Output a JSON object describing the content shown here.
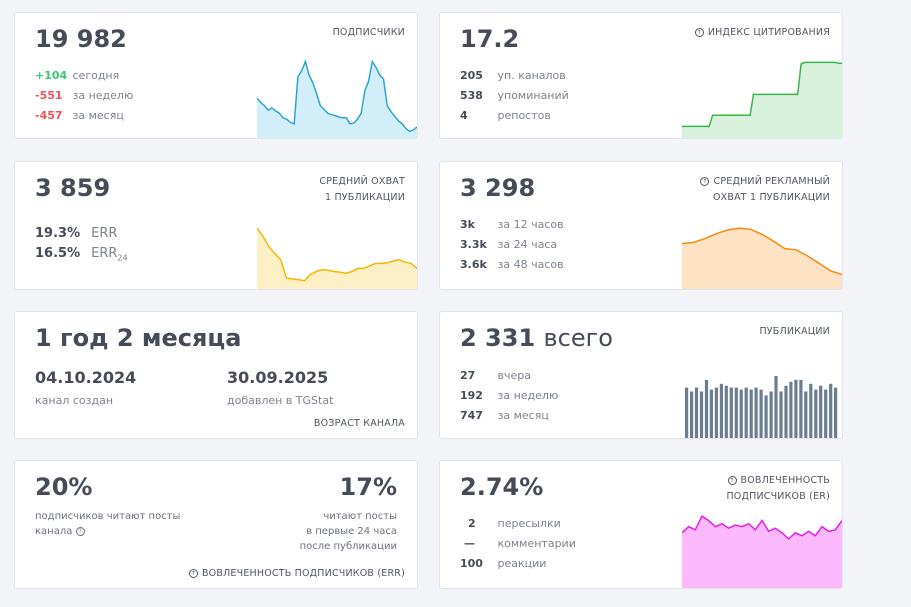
{
  "subscribers": {
    "value": "19 982",
    "title": "ПОДПИСЧИКИ",
    "rows": [
      {
        "v": "+104",
        "l": "сегодня",
        "c": "g"
      },
      {
        "v": "-551",
        "l": "за неделю",
        "c": "r"
      },
      {
        "v": "-457",
        "l": "за месяц",
        "c": "r"
      }
    ],
    "color": "#2ba6d4",
    "fill": "#d2eef8",
    "spark": [
      50,
      44,
      40,
      34,
      37,
      33,
      30,
      24,
      22,
      18,
      16,
      78,
      86,
      98,
      80,
      70,
      56,
      40,
      35,
      30,
      28,
      27,
      25,
      24,
      24,
      16,
      17,
      22,
      30,
      60,
      72,
      98,
      90,
      80,
      75,
      40,
      32,
      26,
      20,
      16,
      10,
      6,
      8,
      12
    ]
  },
  "citation": {
    "value": "17.2",
    "title": "ИНДЕКС ЦИТИРОВАНИЯ",
    "icon": "info-icon",
    "rows": [
      {
        "v": "205",
        "l": "уп. каналов"
      },
      {
        "v": "538",
        "l": "упоминаний"
      },
      {
        "v": "4",
        "l": "репостов"
      }
    ],
    "color": "#3bb54a",
    "fill": "#d8f1dc",
    "spark": [
      12,
      12,
      12,
      12,
      12,
      12,
      12,
      12,
      12,
      26,
      26,
      26,
      26,
      26,
      26,
      26,
      26,
      26,
      26,
      26,
      26,
      52,
      52,
      52,
      52,
      52,
      52,
      52,
      52,
      52,
      52,
      52,
      52,
      52,
      52,
      90,
      92,
      92,
      92,
      92,
      92,
      92,
      92,
      92,
      92,
      92,
      91,
      91
    ]
  },
  "reach": {
    "value": "3 859",
    "title": [
      "СРЕДНИЙ ОХВАТ",
      "1 ПУБЛИКАЦИИ"
    ],
    "rows": [
      {
        "v": "19.3%",
        "l": "ERR"
      },
      {
        "v": "16.5%",
        "l": "ERR",
        "sub": "24"
      }
    ],
    "color": "#f5b800",
    "fill": "#fdf0c7",
    "spark": [
      95,
      82,
      65,
      54,
      44,
      14,
      13,
      12,
      10,
      20,
      25,
      28,
      27,
      25,
      24,
      22,
      25,
      30,
      30,
      34,
      38,
      38,
      39,
      42,
      44,
      40,
      38,
      30
    ]
  },
  "ad_reach": {
    "value": "3 298",
    "title": [
      "СРЕДНИЙ РЕКЛАМНЫЙ",
      "ОХВАТ 1 ПУБЛИКАЦИИ"
    ],
    "icon": "info-icon",
    "rows": [
      {
        "v": "3k",
        "l": "за 12 часов"
      },
      {
        "v": "3.3k",
        "l": "за 24 часа"
      },
      {
        "v": "3.6k",
        "l": "за 48 часов"
      }
    ],
    "color": "#f78a0f",
    "fill": "#fde2c4",
    "spark": [
      70,
      72,
      78,
      86,
      92,
      95,
      93,
      85,
      74,
      62,
      60,
      50,
      38,
      26,
      20
    ]
  },
  "age": {
    "value": "1 год 2 месяца",
    "created": "04.10.2024",
    "created_label": "канал создан",
    "added": "30.09.2025",
    "added_label": "добавлен в TGStat",
    "title": "ВОЗРАСТ КАНАЛА"
  },
  "posts": {
    "value": "2 331",
    "value_suffix": "всего",
    "title": "ПУБЛИКАЦИИ",
    "rows": [
      {
        "v": "27",
        "l": "вчера"
      },
      {
        "v": "192",
        "l": "за неделю"
      },
      {
        "v": "747",
        "l": "за месяц"
      }
    ],
    "color": "#6b7d90",
    "bars": [
      26,
      24,
      26,
      24,
      30,
      25,
      26,
      28,
      27,
      26,
      26,
      25,
      26,
      25,
      26,
      25,
      22,
      24,
      32,
      24,
      27,
      29,
      30,
      30,
      24,
      28,
      25,
      27,
      25,
      28,
      26
    ]
  },
  "err": {
    "value1": "20%",
    "label1": [
      "подписчиков читают посты",
      "канала"
    ],
    "value2": "17%",
    "label2": [
      "читают посты",
      "в первые 24 часа",
      "после публикации"
    ],
    "title": "ВОВЛЕЧЕННОСТЬ ПОДПИСЧИКОВ (ERR)"
  },
  "er": {
    "value": "2.74%",
    "title": [
      "ВОВЛЕЧЕННОСТЬ",
      "ПОДПИСЧИКОВ (ER)"
    ],
    "icon": "info-icon",
    "rows": [
      {
        "v": "2",
        "l": "пересылки"
      },
      {
        "v": "—",
        "l": "комментарии"
      },
      {
        "v": "100",
        "l": "реакции"
      }
    ],
    "color": "#e81ee8",
    "fill": "#fbb8fb",
    "spark": [
      70,
      78,
      74,
      92,
      86,
      78,
      82,
      76,
      80,
      78,
      82,
      74,
      86,
      72,
      76,
      70,
      62,
      70,
      66,
      72,
      66,
      78,
      72,
      74,
      86
    ]
  }
}
